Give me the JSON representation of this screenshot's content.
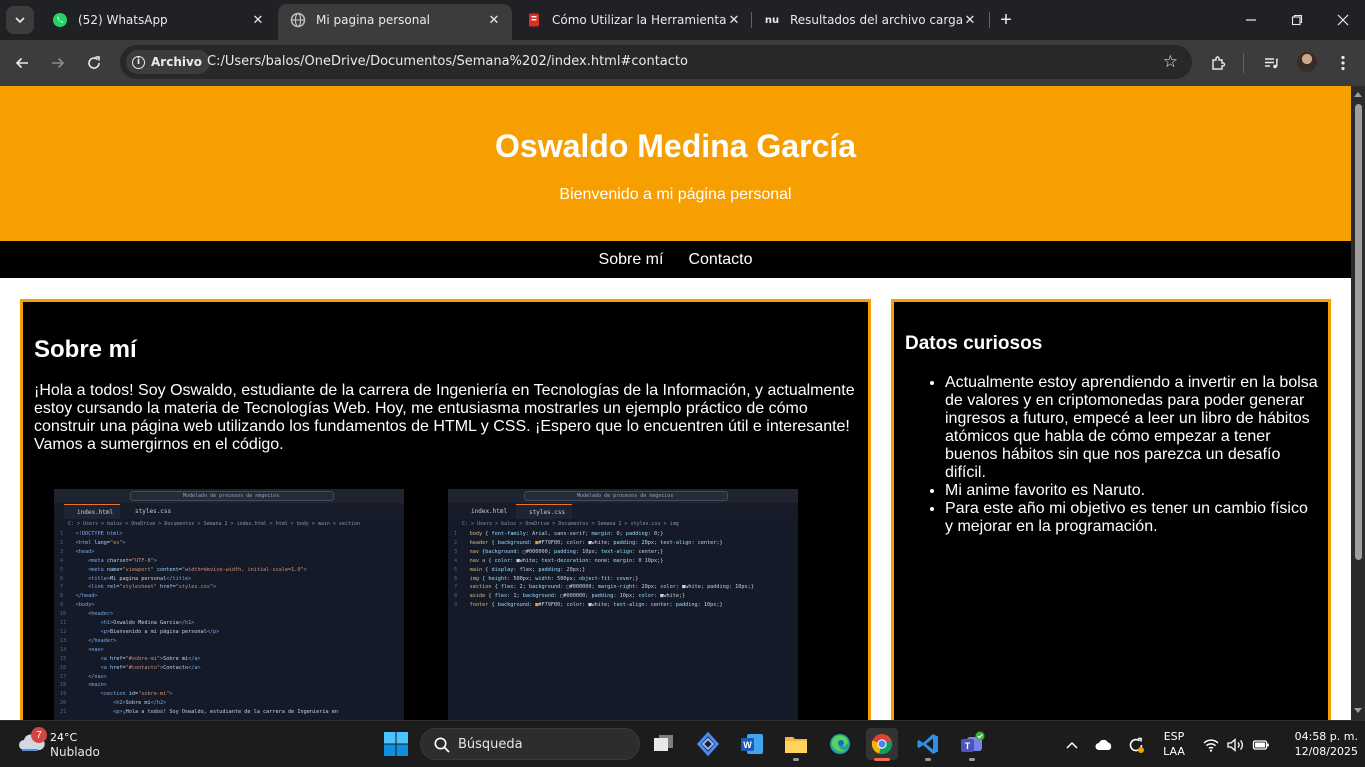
{
  "browser": {
    "tabs": [
      {
        "title": "(52) WhatsApp",
        "icon": "whatsapp-icon",
        "active": false
      },
      {
        "title": "Mi pagina personal",
        "icon": "globe-icon",
        "active": true
      },
      {
        "title": "Cómo Utilizar la Herramienta de",
        "icon": "pdf-icon",
        "active": false
      },
      {
        "title": "Resultados del archivo cargado",
        "icon": "nu-icon",
        "active": false
      }
    ],
    "tab_search_icon": "chevron-down-icon",
    "new_tab": "+",
    "address": {
      "chip_label": "Archivo",
      "url": "C:/Users/balos/OneDrive/Documentos/Semana%202/index.html#contacto"
    }
  },
  "page": {
    "header": {
      "title": "Oswaldo Medina García",
      "subtitle": "Bienvenido a mi página personal"
    },
    "nav": [
      {
        "label": "Sobre mí"
      },
      {
        "label": "Contacto"
      }
    ],
    "about": {
      "heading": "Sobre mí",
      "paragraph": "¡Hola a todos! Soy Oswaldo, estudiante de la carrera de Ingeniería en Tecnologías de la Información, y actualmente estoy cursando la materia de Tecnologías Web. Hoy, me entusiasma mostrarles un ejemplo práctico de cómo construir una página web utilizando los fundamentos de HTML y CSS. ¡Espero que lo encuentren útil e interesante! Vamos a sumergirnos en el código."
    },
    "screenshots": [
      {
        "search": "Modelado de procesos de negocios",
        "tabs": [
          "index.html",
          "styles.css"
        ],
        "active_tab": 0,
        "crumb": "C: > Users > balos > OneDrive > Documentos > Semana 2 > index.html > html > body > main > section"
      },
      {
        "search": "Modelado de procesos de negocios",
        "tabs": [
          "index.html",
          "styles.css"
        ],
        "active_tab": 1,
        "crumb": "C: > Users > balos > OneDrive > Documentos > Semana 2 > styles.css > img"
      }
    ],
    "aside": {
      "heading": "Datos curiosos",
      "items": [
        "Actualmente estoy aprendiendo a invertir en la bolsa de valores y en criptomonedas para poder generar ingresos a futuro, empecé a leer un libro de hábitos atómicos que habla de cómo empezar a tener buenos hábitos sin que nos parezca un desafío difícil.",
        "Mi anime favorito es Naruto.",
        "Para este año mi objetivo es tener un cambio físico y mejorar en la programación."
      ]
    },
    "colors": {
      "accent_orange": "#f79f00",
      "nav_black": "#000000",
      "text_white": "#ffffff"
    }
  },
  "taskbar": {
    "weather": {
      "temp": "24°C",
      "condition": "Nublado",
      "badge": "7"
    },
    "search_placeholder": "Búsqueda",
    "apps": [
      "task-view-icon",
      "copilot-icon",
      "word-icon",
      "file-explorer-icon",
      "edge-icon",
      "chrome-icon",
      "vscode-icon",
      "teams-icon"
    ],
    "language": {
      "line1": "ESP",
      "line2": "LAA"
    },
    "clock": {
      "time": "04:58 p. m.",
      "date": "12/08/2025"
    }
  }
}
